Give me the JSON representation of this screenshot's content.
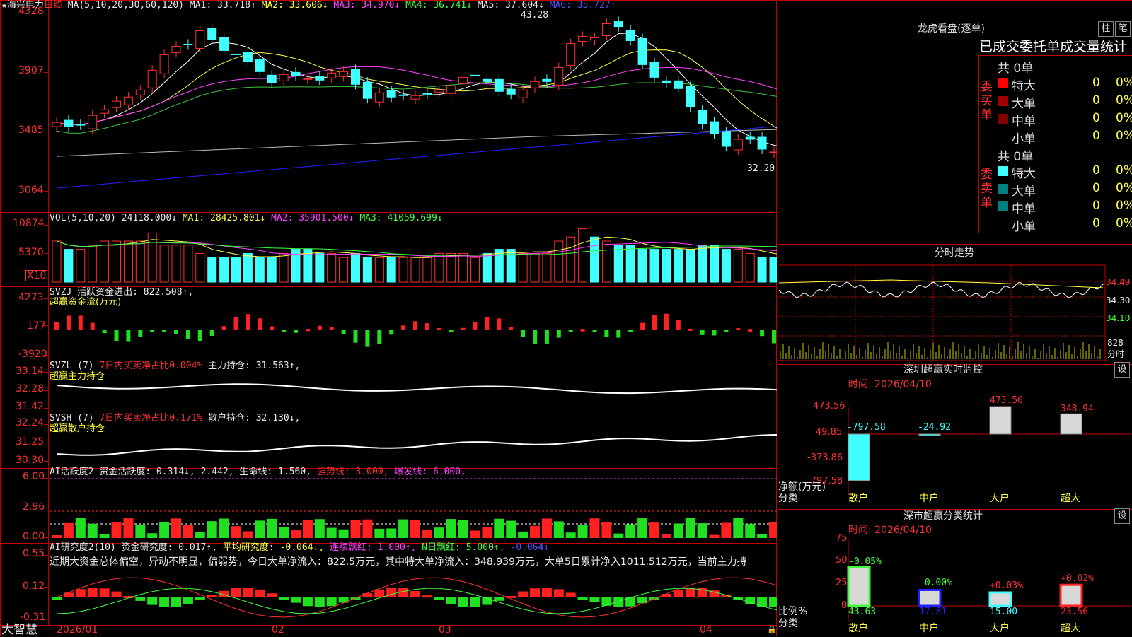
{
  "stock": {
    "star": "★",
    "name": "海兴电力",
    "period": "日线"
  },
  "ma_line": {
    "label": "MA(5,10,20,30,60,120)",
    "ma1": "MA1: 33.718↑",
    "ma2": "MA2: 33.606↓",
    "ma3": "MA3: 34.970↓",
    "ma4": "MA4: 36.741↓",
    "ma5": "MA5: 37.604↓",
    "ma6": "MA6: 35.727↑"
  },
  "price_axis": [
    "4328",
    "3907",
    "3485",
    "3064"
  ],
  "price_annot": {
    "high": "43.28",
    "low": "32.20"
  },
  "vol_line": {
    "label": "VOL(5,10,20)",
    "v": "24118.000↓",
    "ma1": "MA1: 28425.801↓",
    "ma2": "MA2: 35901.500↓",
    "ma3": "MA3: 41059.699↓"
  },
  "vol_axis": [
    "10874",
    "5370"
  ],
  "vol_unit": "X10",
  "svzj": {
    "label": "SVZJ",
    "desc": "活跃资金进出: 822.508↑,",
    "sub": "超赢资金流(万元)",
    "axis": [
      "4273",
      "177",
      "-3920"
    ]
  },
  "svzl": {
    "label": "SVZL (7)",
    "desc": "7日内买卖净占比0.004%",
    "hold": "主力持仓: 31.563↑,",
    "sub": "超赢主力持仓",
    "axis": [
      "33.14",
      "32.28",
      "31.42"
    ]
  },
  "svsh": {
    "label": "SVSH (7)",
    "desc": "7日内买卖净占比0.171%",
    "hold": "散户持仓: 32.130↓,",
    "sub": "超赢散户持仓",
    "axis": [
      "32.24",
      "31.25",
      "30.30"
    ]
  },
  "ai1": {
    "label": "AI活跃度2",
    "a": "资金活跃度: 0.314↓,",
    "b": "2.442,",
    "c": "生命线: 1.560,",
    "d": "强势线: 3.000,",
    "e": "爆发线: 6.000,",
    "axis": [
      "6.00",
      "2.96",
      "0.00"
    ]
  },
  "ai2": {
    "label": "AI研究度2(10)",
    "a": "资金研究度: 0.017↑,",
    "b": "平均研究度: -0.064↓,",
    "c": "连续飘红: 1.000↑,",
    "d": "N日飘红: 5.000↑,",
    "e": "-0.064↓",
    "summary": "近期大资金总体偏空，异动不明显，偏弱势，今日大单净流入：822.5万元，其中特大单净流入：348.939万元，大单5日累计净入1011.512万元，当前主力持",
    "axis": [
      "0.55",
      "0.12",
      "-0.31"
    ]
  },
  "date_axis": [
    "2026/01",
    "02",
    "03",
    "04"
  ],
  "brand": "大智慧",
  "right": {
    "title": "龙虎看盘(逐单)",
    "btn1": "柱",
    "btn2": "笔",
    "tabs": "已成交委托单成交量统计",
    "buy_label": "委买单",
    "sell_label": "委卖单",
    "buy_total": "共 0单",
    "sell_total": "共 0单",
    "buy_rows": [
      {
        "name": "特大",
        "n": "0",
        "p": "0%"
      },
      {
        "name": "大单",
        "n": "0",
        "p": "0%"
      },
      {
        "name": "中单",
        "n": "0",
        "p": "0%"
      },
      {
        "name": "小单",
        "n": "0",
        "p": "0%"
      }
    ],
    "sell_rows": [
      {
        "name": "特大",
        "n": "0",
        "p": "0%"
      },
      {
        "name": "大单",
        "n": "0",
        "p": "0%"
      },
      {
        "name": "中单",
        "n": "0",
        "p": "0%"
      },
      {
        "name": "小单",
        "n": "0",
        "p": "0%"
      }
    ],
    "mini_title": "分时走势",
    "mini_axis": [
      "34.49",
      "34.30",
      "34.10",
      "828",
      "分时"
    ],
    "sz_title": "深圳超赢实时监控",
    "sz_btn": "设",
    "sz_time": "时间: 2026/04/10",
    "sz_axis": [
      "473.56",
      "49.85",
      "-373.86",
      "-797.58"
    ],
    "sz_unit1": "净额(万元)",
    "sz_unit2": "分类",
    "sz_values": [
      "-797.58",
      "-24.92",
      "473.56",
      "348.94"
    ],
    "sz_cats": [
      "散户",
      "中户",
      "大户",
      "超大"
    ],
    "sc_title": "深市超赢分类统计",
    "sc_btn": "设",
    "sc_time": "时间: 2026/04/10",
    "sc_axis": [
      "75",
      "50",
      "25",
      "0"
    ],
    "sc_unit1": "比例%",
    "sc_unit2": "分类",
    "sc_top": [
      "-0.05%",
      "-0.00%",
      "+0.03%",
      "+0.02%"
    ],
    "sc_values": [
      "43.63",
      "17.81",
      "15.00",
      "23.56"
    ],
    "sc_cats": [
      "散户",
      "中户",
      "大户",
      "超大"
    ]
  },
  "chart_data": [
    {
      "type": "candlestick",
      "title": "海兴电力 日线",
      "ylim": [
        30.64,
        43.28
      ],
      "close": [
        35.5,
        35.2,
        35.3,
        36.0,
        36.4,
        37.0,
        37.3,
        37.8,
        39.2,
        40.3,
        40.9,
        41.0,
        42.0,
        41.4,
        40.6,
        40.3,
        39.8,
        39.1,
        38.3,
        38.9,
        38.8,
        38.6,
        38.5,
        39.0,
        39.1,
        38.2,
        37.2,
        37.6,
        37.3,
        37.4,
        37.4,
        37.5,
        37.8,
        38.1,
        38.7,
        38.8,
        38.4,
        37.7,
        37.5,
        37.8,
        38.4,
        38.4,
        39.4,
        41.1,
        41.6,
        41.5,
        42.5,
        42.3,
        41.3,
        39.6,
        38.7,
        38.3,
        37.9,
        36.6,
        35.4,
        34.7,
        33.8,
        34.3,
        34.3,
        33.6,
        33.4,
        33.0,
        33.1,
        33.1,
        33.1,
        32.6,
        32.8,
        33.4,
        34.0,
        34.1,
        33.8
      ]
    },
    {
      "type": "bar",
      "title": "VOL",
      "values": [
        10,
        8,
        8,
        9,
        10,
        10,
        10,
        10,
        12,
        9,
        9,
        9,
        7,
        6,
        6,
        6,
        7,
        6,
        6,
        7,
        8,
        8,
        7,
        7,
        6,
        7,
        6,
        6,
        6,
        6,
        6,
        6,
        7,
        7,
        7,
        6,
        7,
        8,
        8,
        7,
        7,
        7,
        10,
        11,
        13,
        11,
        10,
        9,
        9,
        8,
        8,
        8,
        8,
        8,
        9,
        9,
        8,
        8,
        7,
        6,
        6,
        6,
        6,
        6,
        6,
        6,
        6,
        6,
        5,
        5,
        5
      ]
    }
  ]
}
